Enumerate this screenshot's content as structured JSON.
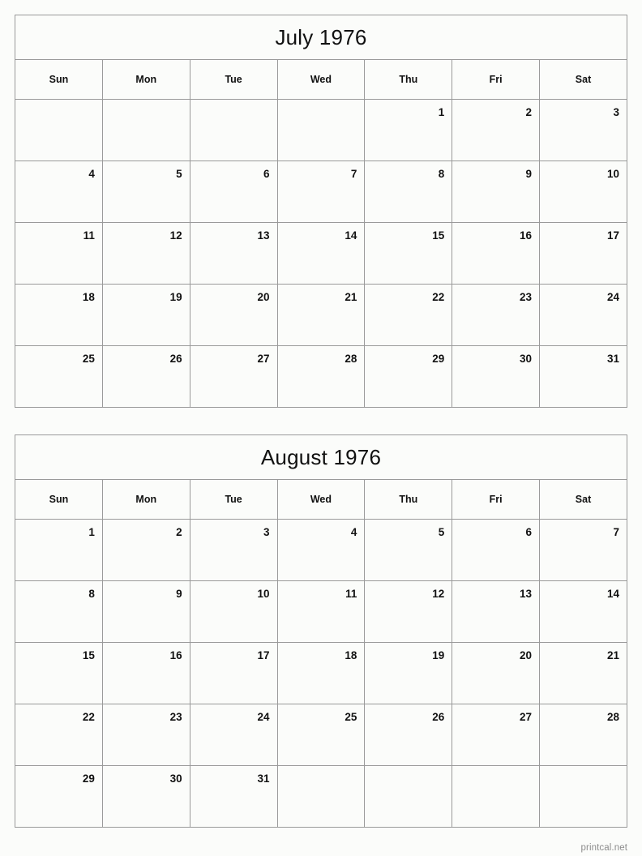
{
  "page": {
    "background_color": "#fbfcfa",
    "border_color": "#9a9a9a",
    "text_color": "#111111"
  },
  "footer": {
    "label": "printcal.net",
    "color": "#8c8c8c"
  },
  "weekday_headers": [
    "Sun",
    "Mon",
    "Tue",
    "Wed",
    "Thu",
    "Fri",
    "Sat"
  ],
  "calendars": [
    {
      "title": "July 1976",
      "month": "July",
      "year": "1976",
      "weeks": [
        [
          "",
          "",
          "",
          "",
          "1",
          "2",
          "3"
        ],
        [
          "4",
          "5",
          "6",
          "7",
          "8",
          "9",
          "10"
        ],
        [
          "11",
          "12",
          "13",
          "14",
          "15",
          "16",
          "17"
        ],
        [
          "18",
          "19",
          "20",
          "21",
          "22",
          "23",
          "24"
        ],
        [
          "25",
          "26",
          "27",
          "28",
          "29",
          "30",
          "31"
        ]
      ]
    },
    {
      "title": "August 1976",
      "month": "August",
      "year": "1976",
      "weeks": [
        [
          "1",
          "2",
          "3",
          "4",
          "5",
          "6",
          "7"
        ],
        [
          "8",
          "9",
          "10",
          "11",
          "12",
          "13",
          "14"
        ],
        [
          "15",
          "16",
          "17",
          "18",
          "19",
          "20",
          "21"
        ],
        [
          "22",
          "23",
          "24",
          "25",
          "26",
          "27",
          "28"
        ],
        [
          "29",
          "30",
          "31",
          "",
          "",
          "",
          ""
        ]
      ]
    }
  ]
}
